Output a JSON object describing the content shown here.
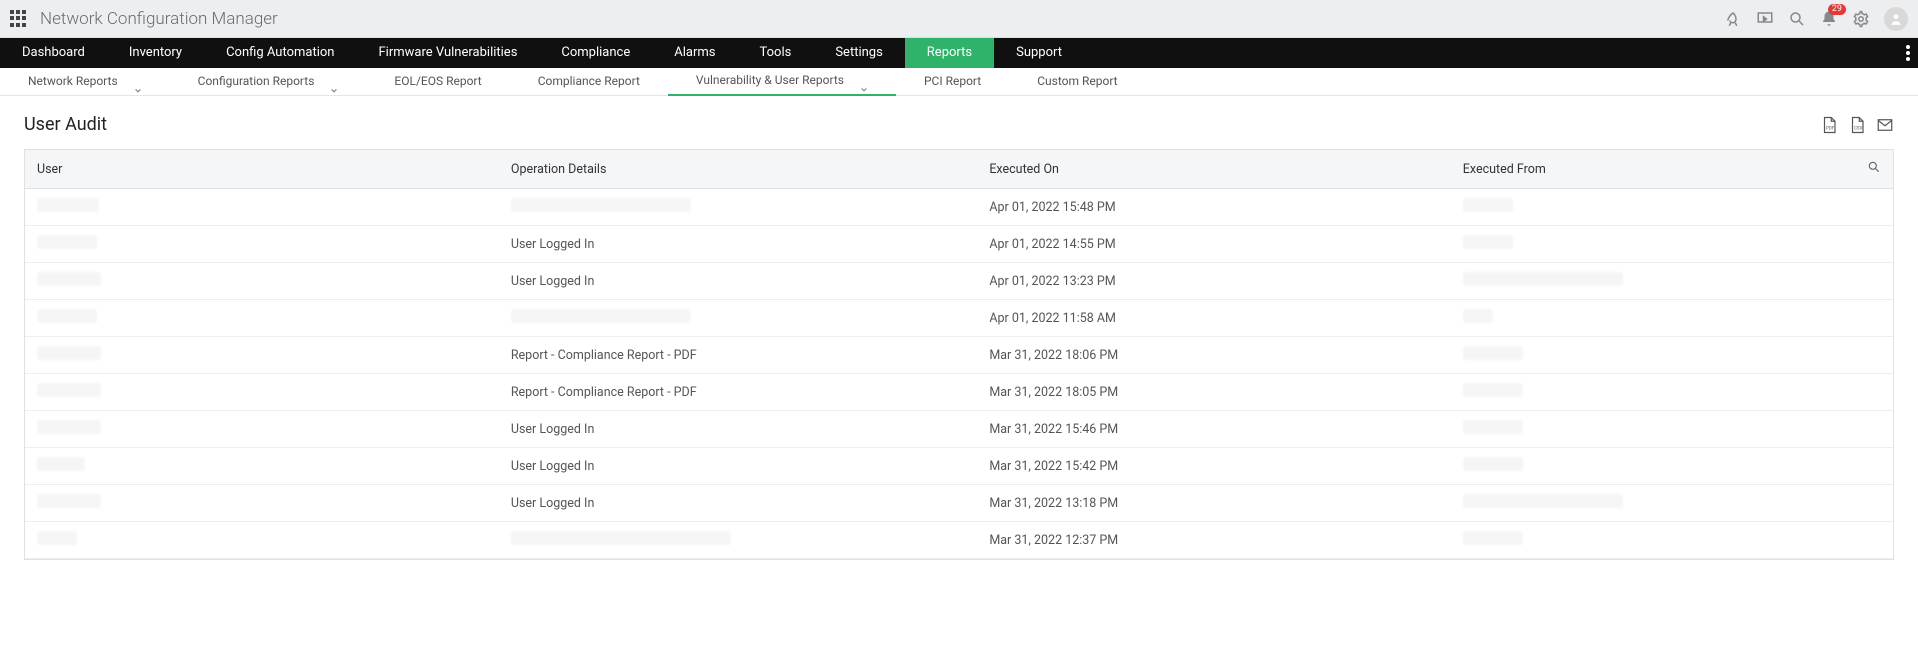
{
  "app": {
    "title": "Network Configuration Manager"
  },
  "notifications": {
    "count": "29"
  },
  "main_nav": {
    "items": [
      {
        "label": "Dashboard"
      },
      {
        "label": "Inventory"
      },
      {
        "label": "Config Automation"
      },
      {
        "label": "Firmware Vulnerabilities"
      },
      {
        "label": "Compliance"
      },
      {
        "label": "Alarms"
      },
      {
        "label": "Tools"
      },
      {
        "label": "Settings"
      },
      {
        "label": "Reports",
        "active": true
      },
      {
        "label": "Support"
      }
    ]
  },
  "sub_nav": {
    "items": [
      {
        "label": "Network Reports",
        "dropdown": true
      },
      {
        "label": "Configuration Reports",
        "dropdown": true
      },
      {
        "label": "EOL/EOS Report"
      },
      {
        "label": "Compliance Report"
      },
      {
        "label": "Vulnerability & User Reports",
        "dropdown": true,
        "active": true
      },
      {
        "label": "PCI Report"
      },
      {
        "label": "Custom Report"
      }
    ]
  },
  "page": {
    "title": "User Audit"
  },
  "table": {
    "columns": {
      "user": "User",
      "operation": "Operation Details",
      "executed_on": "Executed On",
      "executed_from": "Executed From"
    },
    "rows": [
      {
        "user": "",
        "operation": "",
        "executed_on": "Apr 01, 2022 15:48 PM",
        "executed_from": ""
      },
      {
        "user": "",
        "operation": "User Logged In",
        "executed_on": "Apr 01, 2022 14:55 PM",
        "executed_from": ""
      },
      {
        "user": "",
        "operation": "User Logged In",
        "executed_on": "Apr 01, 2022 13:23 PM",
        "executed_from": ""
      },
      {
        "user": "",
        "operation": "",
        "executed_on": "Apr 01, 2022 11:58 AM",
        "executed_from": ""
      },
      {
        "user": "",
        "operation": "Report - Compliance Report - PDF",
        "executed_on": "Mar 31, 2022 18:06 PM",
        "executed_from": ""
      },
      {
        "user": "",
        "operation": "Report - Compliance Report - PDF",
        "executed_on": "Mar 31, 2022 18:05 PM",
        "executed_from": ""
      },
      {
        "user": "",
        "operation": "User Logged In",
        "executed_on": "Mar 31, 2022 15:46 PM",
        "executed_from": ""
      },
      {
        "user": "",
        "operation": "User Logged In",
        "executed_on": "Mar 31, 2022 15:42 PM",
        "executed_from": ""
      },
      {
        "user": "",
        "operation": "User Logged In",
        "executed_on": "Mar 31, 2022 13:18 PM",
        "executed_from": ""
      },
      {
        "user": "",
        "operation": "",
        "executed_on": "Mar 31, 2022 12:37 PM",
        "executed_from": ""
      }
    ],
    "redacted_widths": {
      "user": [
        62,
        60,
        64,
        60,
        64,
        64,
        64,
        48,
        64,
        40
      ],
      "operation": [
        180,
        0,
        0,
        180,
        0,
        0,
        0,
        0,
        0,
        220
      ],
      "from": [
        50,
        50,
        160,
        30,
        60,
        60,
        60,
        60,
        160,
        60
      ]
    }
  }
}
